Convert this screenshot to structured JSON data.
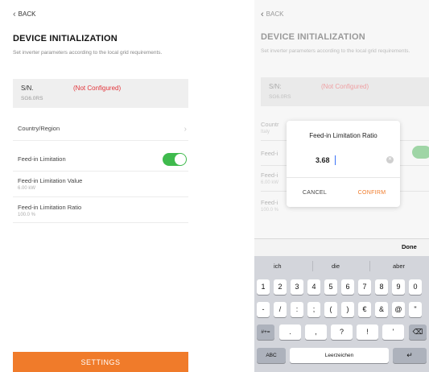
{
  "left": {
    "back_label": "BACK",
    "title": "DEVICE INITIALIZATION",
    "subtitle": "Set inverter parameters according to the local grid requirements.",
    "sn": {
      "label": "S/N.",
      "status": "(Not Configured)",
      "value": "SG6.0RS"
    },
    "country_label": "Country/Region",
    "feedin_label": "Feed-in Limitation",
    "feedin_value_label": "Feed-in Limitation Value",
    "feedin_value": "6.00 kW",
    "feedin_ratio_label": "Feed-in Limitation Ratio",
    "feedin_ratio": "100.0 %",
    "settings_button": "SETTINGS"
  },
  "right": {
    "back_label": "BACK",
    "title": "DEVICE INITIALIZATION",
    "subtitle": "Set inverter parameters according to the local grid requirements.",
    "sn": {
      "label": "S/N:",
      "status": "(Not Configured)",
      "value": "SG6.0RS"
    },
    "country_label": "Countr",
    "country_value": "Italy",
    "feedin_label": "Feed-i",
    "feedin_value_label": "Feed-i",
    "feedin_value": "6.00 kW",
    "feedin_ratio_label": "Feed-i",
    "feedin_ratio": "100.0 %",
    "dialog": {
      "title": "Feed-in Limitation Ratio",
      "input_value": "3.68",
      "cancel": "CANCEL",
      "confirm": "CONFIRM"
    },
    "done_label": "Done",
    "keyboard": {
      "suggestions": [
        "ich",
        "die",
        "aber"
      ],
      "row1": [
        "1",
        "2",
        "3",
        "4",
        "5",
        "6",
        "7",
        "8",
        "9",
        "0"
      ],
      "row2": [
        "-",
        "/",
        ":",
        ";",
        "(",
        ")",
        "€",
        "&",
        "@",
        "\""
      ],
      "row3_left": "#+=",
      "row3": [
        ".",
        ",",
        "?",
        "!",
        "'"
      ],
      "row3_right": "⌫",
      "abc": "ABC",
      "space": "Leerzeichen",
      "return": "↵"
    }
  },
  "colors": {
    "accent": "#f07b2a",
    "toggle_on": "#3fba4d",
    "error": "#e2343a"
  }
}
